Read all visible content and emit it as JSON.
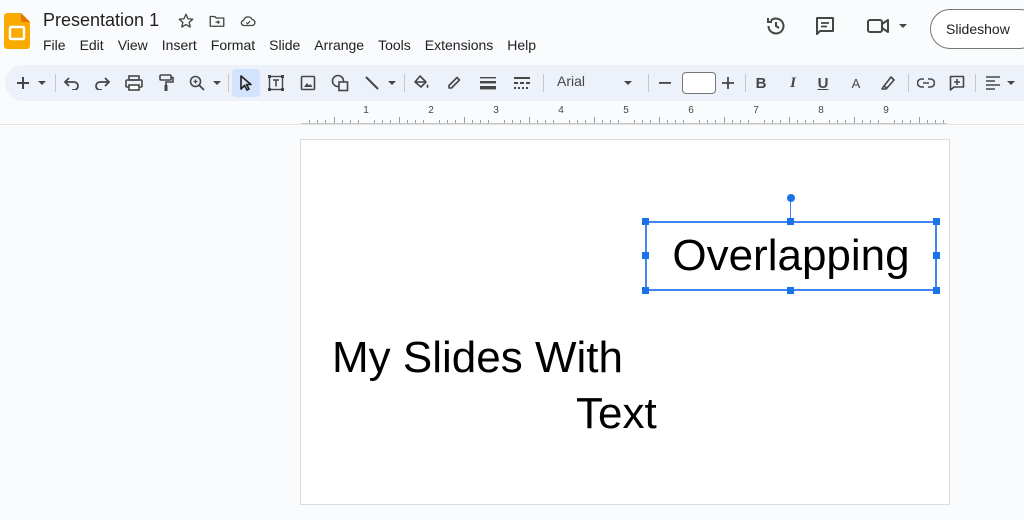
{
  "window": {
    "title": "Presentation 1"
  },
  "menu": [
    "File",
    "Edit",
    "View",
    "Insert",
    "Format",
    "Slide",
    "Arrange",
    "Tools",
    "Extensions",
    "Help"
  ],
  "header": {
    "slideshow_label": "Slideshow"
  },
  "toolbar": {
    "font_name": "Arial",
    "font_size": ""
  },
  "ruler": {
    "labels": [
      "1",
      "2",
      "3",
      "4",
      "5",
      "6",
      "7",
      "8",
      "9"
    ]
  },
  "slide": {
    "overlap_text": "Overlapping",
    "main_text_line1": "My Slides With",
    "main_text_line2": "Text"
  },
  "colors": {
    "accent": "#1a73e8",
    "toolbar_bg": "#edf2fa",
    "app_bg": "#f9fbfd"
  },
  "icons": [
    "slides-logo",
    "star-icon",
    "move-folder-icon",
    "cloud-icon",
    "history-icon",
    "comment-icon",
    "meet-icon"
  ]
}
